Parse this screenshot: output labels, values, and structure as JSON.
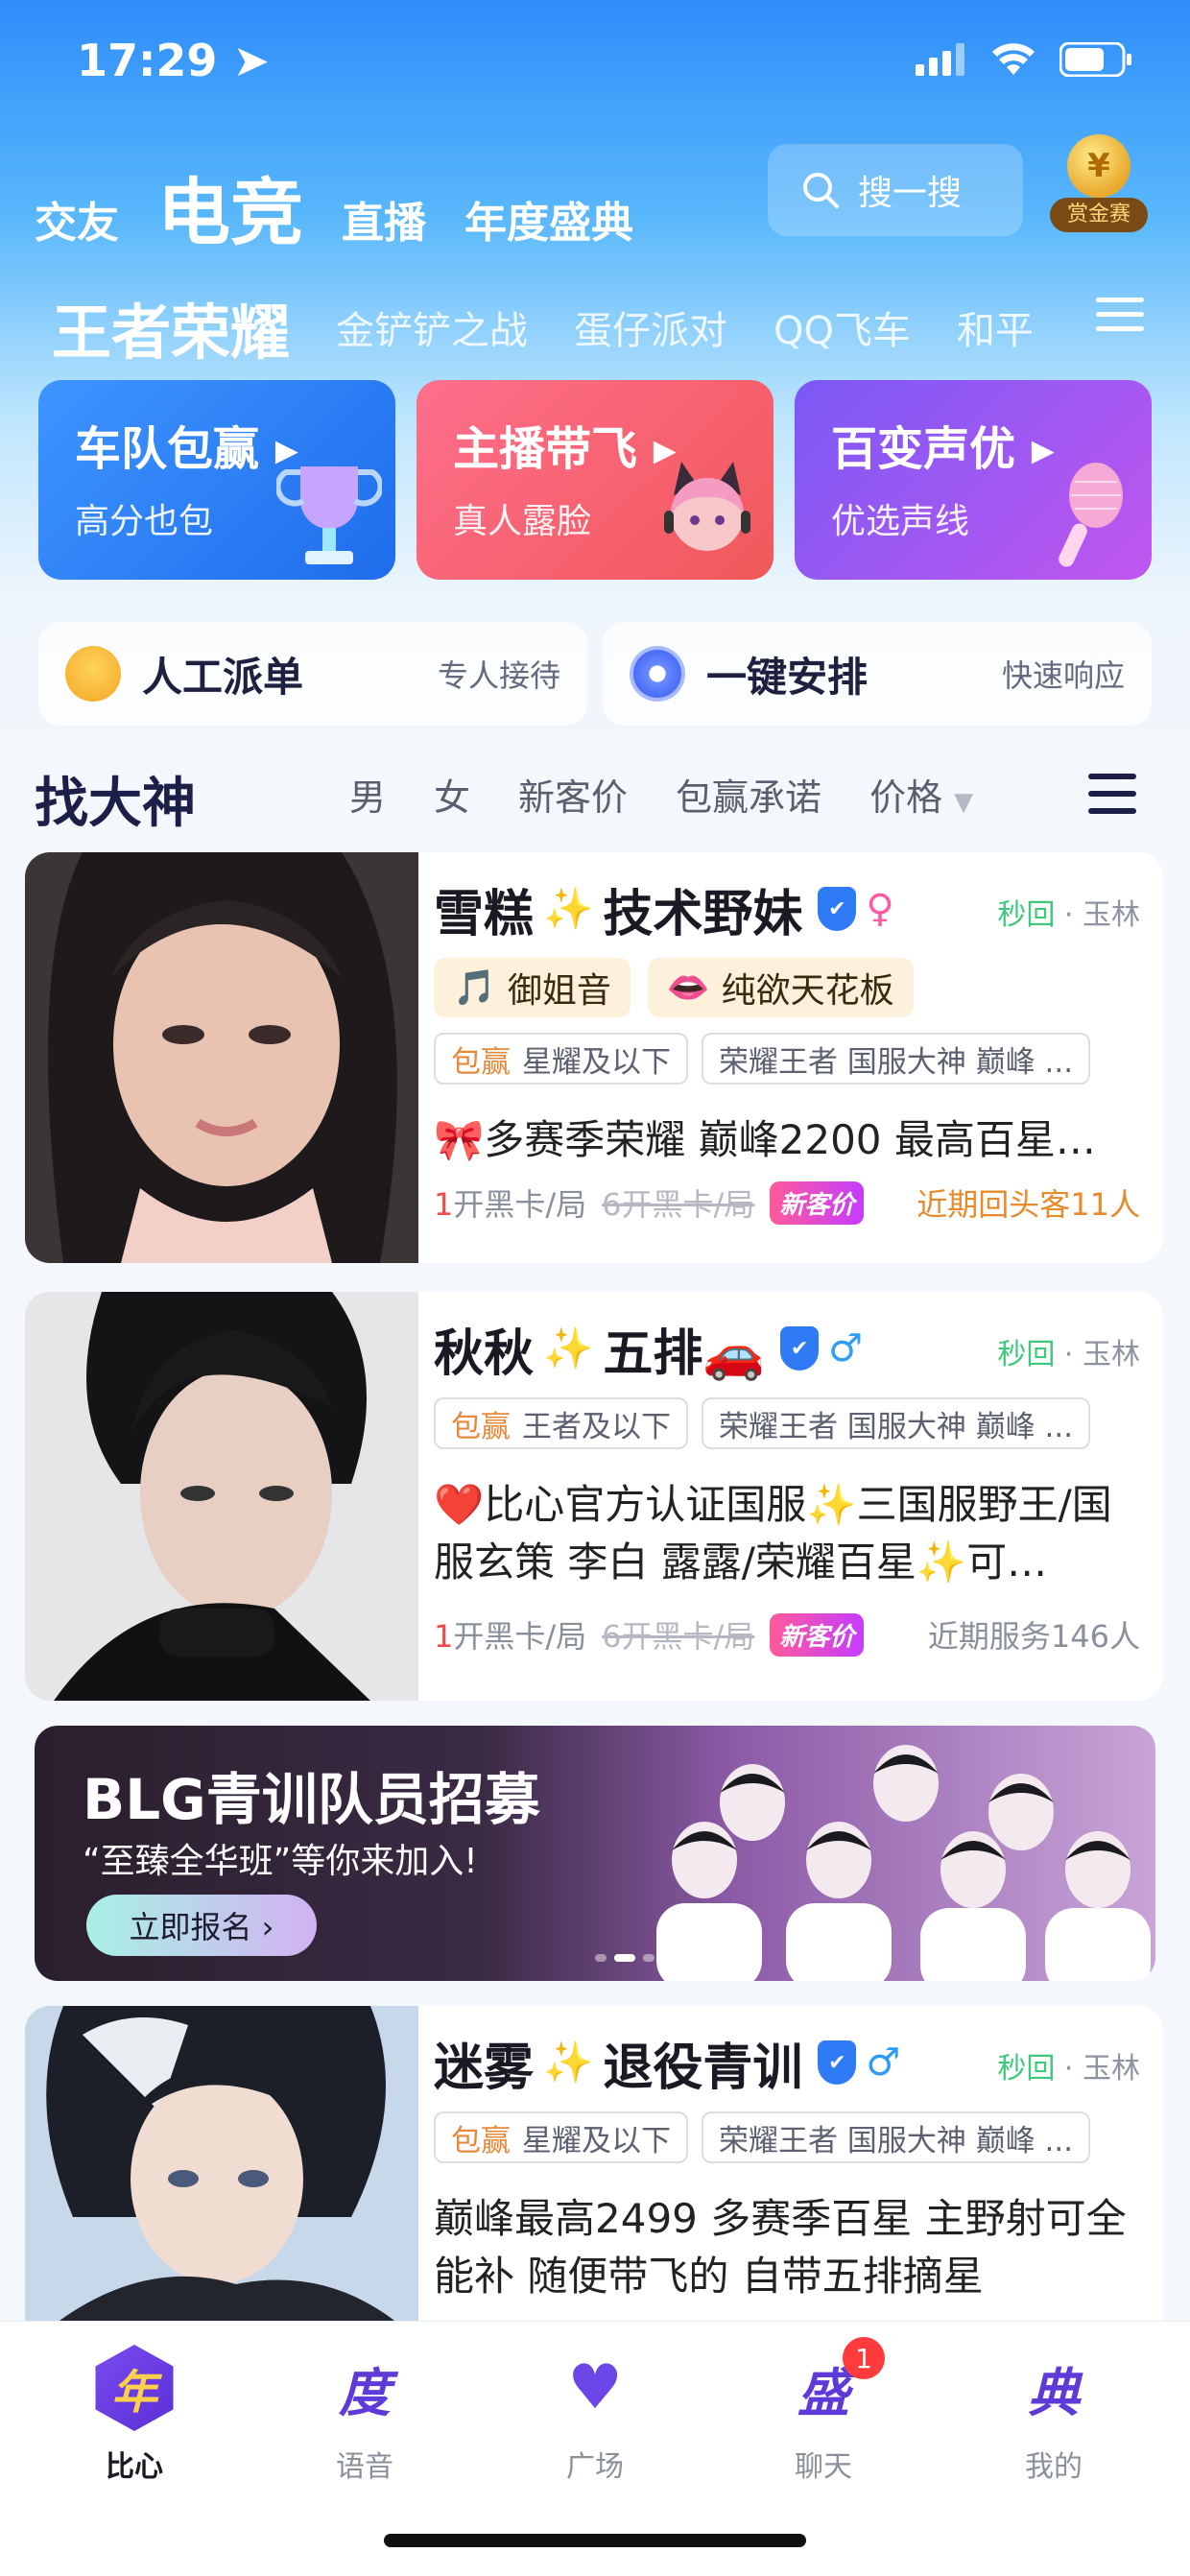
{
  "status_bar": {
    "time": "17:29"
  },
  "top_tabs": [
    {
      "label": "交友"
    },
    {
      "label": "电竞"
    },
    {
      "label": "直播"
    },
    {
      "label": "年度盛典"
    }
  ],
  "search": {
    "placeholder": "搜一搜"
  },
  "bounty": {
    "label": "赏金赛"
  },
  "games": [
    {
      "label": "王者荣耀"
    },
    {
      "label": "金铲铲之战"
    },
    {
      "label": "蛋仔派对"
    },
    {
      "label": "QQ飞车"
    },
    {
      "label": "和平"
    }
  ],
  "promos": [
    {
      "title": "车队包赢",
      "subtitle": "高分也包",
      "color_from": "#3a8ff8",
      "color_to": "#1f6fe8"
    },
    {
      "title": "主播带飞",
      "subtitle": "真人露脸",
      "color_from": "#ff6b86",
      "color_to": "#f25b5b"
    },
    {
      "title": "百变声优",
      "subtitle": "优选声线",
      "color_from": "#8b5cf6",
      "color_to": "#c45cf2"
    }
  ],
  "services": [
    {
      "title": "人工派单",
      "subtitle": "专人接待"
    },
    {
      "title": "一键安排",
      "subtitle": "快速响应"
    }
  ],
  "filter": {
    "title": "找大神",
    "items": [
      "男",
      "女",
      "新客价",
      "包赢承诺",
      "价格"
    ]
  },
  "players": [
    {
      "name": "雪糕",
      "title": "技术野妹",
      "gender": "♀",
      "gender_color": "#ff5aa0",
      "reply": "秒回",
      "location": "玉林",
      "voice_tags": [
        {
          "icon": "🎵",
          "label": "御姐音"
        },
        {
          "icon": "👄",
          "label": "纯欲天花板"
        }
      ],
      "rank_tag": {
        "highlight": "包赢",
        "text": "星耀及以下"
      },
      "rank_tag2": "荣耀王者 国服大神 巅峰 ...",
      "desc": "🎀多赛季荣耀 巅峰2200 最高百星…",
      "price_num": "1",
      "price_unit": "开黑卡/局",
      "price_old": "6开黑卡/局",
      "new_badge": "新客价",
      "stat": "近期回头客11人"
    },
    {
      "name": "秋秋",
      "title": "五排🚗",
      "gender": "♂",
      "gender_color": "#2f9cf6",
      "reply": "秒回",
      "location": "玉林",
      "rank_tag": {
        "highlight": "包赢",
        "text": "王者及以下"
      },
      "rank_tag2": "荣耀王者 国服大神 巅峰 ...",
      "desc": "❤️比心官方认证国服✨三国服野王/国服玄策 李白 露露/荣耀百星✨可…",
      "price_num": "1",
      "price_unit": "开黑卡/局",
      "price_old": "6开黑卡/局",
      "new_badge": "新客价",
      "stat": "近期服务146人"
    },
    {
      "name": "迷雾",
      "title": "退役青训",
      "gender": "♂",
      "gender_color": "#2f9cf6",
      "reply": "秒回",
      "location": "玉林",
      "rank_tag": {
        "highlight": "包赢",
        "text": "星耀及以下"
      },
      "rank_tag2": "荣耀王者 国服大神 巅峰 ...",
      "desc": "巅峰最高2499  多赛季百星 主野射可全能补 随便带飞的 自带五排摘星"
    }
  ],
  "banner": {
    "title": "BLG青训队员招募",
    "subtitle": "“至臻全华班”等你来加入!",
    "button": "立即报名 ›"
  },
  "bottom_nav": [
    {
      "glyph": "年",
      "label": "比心"
    },
    {
      "glyph": "度",
      "label": "语音"
    },
    {
      "glyph": "♥",
      "label": "广场"
    },
    {
      "glyph": "盛",
      "label": "聊天",
      "badge": "1"
    },
    {
      "glyph": "典",
      "label": "我的"
    }
  ]
}
